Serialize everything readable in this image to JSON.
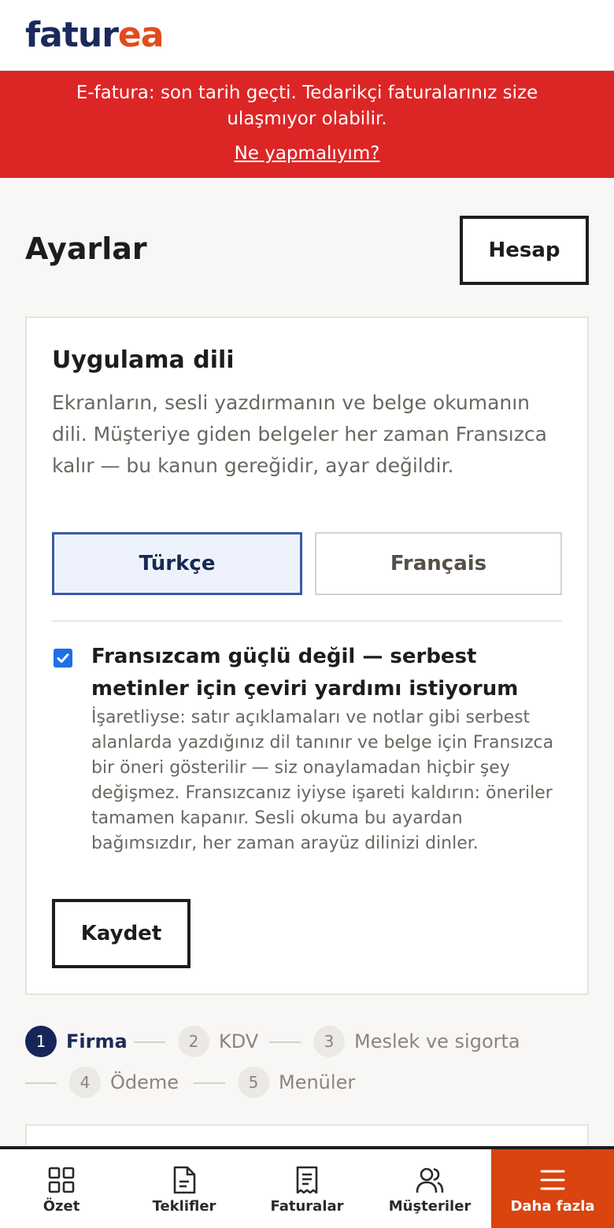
{
  "app": {
    "logo_part1": "fatur",
    "logo_part2": "ea"
  },
  "banner": {
    "message": "E-fatura: son tarih geçti. Tedarikçi faturalarınız size ulaşmıyor olabilir.",
    "link_label": "Ne yapmalıyım?"
  },
  "page": {
    "title": "Ayarlar",
    "account_button": "Hesap"
  },
  "language_card": {
    "title": "Uygulama dili",
    "description": "Ekranların, sesli yazdırmanın ve belge okumanın dili. Müşteriye giden belgeler her zaman Fransızca kalır — bu kanun gereğidir, ayar değildir.",
    "options": [
      "Türkçe",
      "Français"
    ],
    "selected": "Türkçe",
    "translation_help": {
      "checked": true,
      "label": "Fransızcam güçlü değil — serbest metinler için çeviri yardımı istiyorum",
      "description": "İşaretliyse: satır açıklamaları ve notlar gibi serbest alanlarda yazdığınız dil tanınır ve belge için Fransızca bir öneri gösterilir — siz onaylamadan hiçbir şey değişmez. Fransızcanız iyiyse işareti kaldırın: öneriler tamamen kapanır. Sesli okuma bu ayardan bağımsızdır, her zaman arayüz dilinizi dinler."
    },
    "save_button": "Kaydet"
  },
  "stepper": {
    "steps": [
      {
        "num": "1",
        "label": "Firma",
        "active": true
      },
      {
        "num": "2",
        "label": "KDV",
        "active": false
      },
      {
        "num": "3",
        "label": "Meslek ve sigorta",
        "active": false
      },
      {
        "num": "4",
        "label": "Ödeme",
        "active": false
      },
      {
        "num": "5",
        "label": "Menüler",
        "active": false
      }
    ]
  },
  "bottom_nav": {
    "items": [
      {
        "label": "Özet",
        "icon": "grid-icon"
      },
      {
        "label": "Teklifler",
        "icon": "document-icon"
      },
      {
        "label": "Faturalar",
        "icon": "receipt-icon"
      },
      {
        "label": "Müşteriler",
        "icon": "users-icon"
      },
      {
        "label": "Daha fazla",
        "icon": "menu-icon"
      }
    ]
  },
  "colors": {
    "brand_navy": "#1b2a5c",
    "brand_orange": "#e24b1f",
    "banner_red": "#dc2626",
    "nav_more_bg": "#d9440f",
    "selected_border": "#3b5aa8"
  }
}
